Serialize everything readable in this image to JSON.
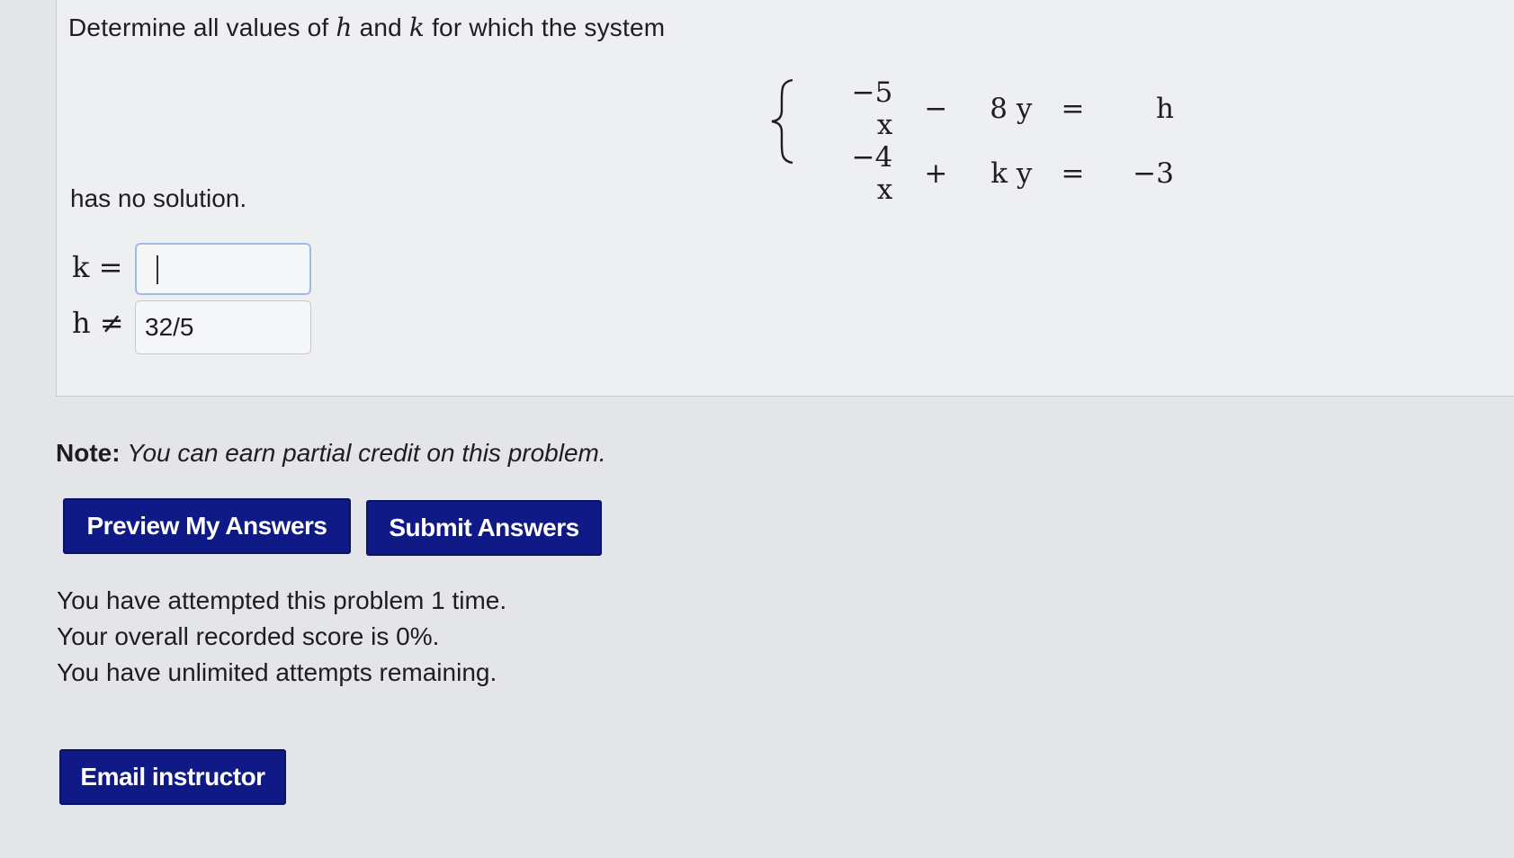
{
  "problem": {
    "intro_prefix": "Determine all values of",
    "var_h": "h",
    "intro_and": "and",
    "var_k": "k",
    "intro_suffix": "for which the system",
    "system": {
      "rows": [
        [
          "−5 x",
          "−",
          "8 y",
          "=",
          "h"
        ],
        [
          "−4 x",
          "+",
          "k y",
          "=",
          "−3"
        ]
      ]
    },
    "no_solution_text": "has no solution.",
    "answers": {
      "k": {
        "label": "k =",
        "value": ""
      },
      "h": {
        "label": "h ≠",
        "value": "32/5"
      }
    }
  },
  "note": {
    "label": "Note:",
    "text": "You can earn partial credit on this problem."
  },
  "buttons": {
    "preview": "Preview My Answers",
    "submit": "Submit Answers",
    "email": "Email instructor"
  },
  "status": {
    "attempts": "You have attempted this problem 1 time.",
    "score": "Your overall recorded score is 0%.",
    "remaining": "You have unlimited attempts remaining."
  },
  "colors": {
    "button_bg": "#0f1a86",
    "input_focus_border": "#9dbbe6"
  }
}
